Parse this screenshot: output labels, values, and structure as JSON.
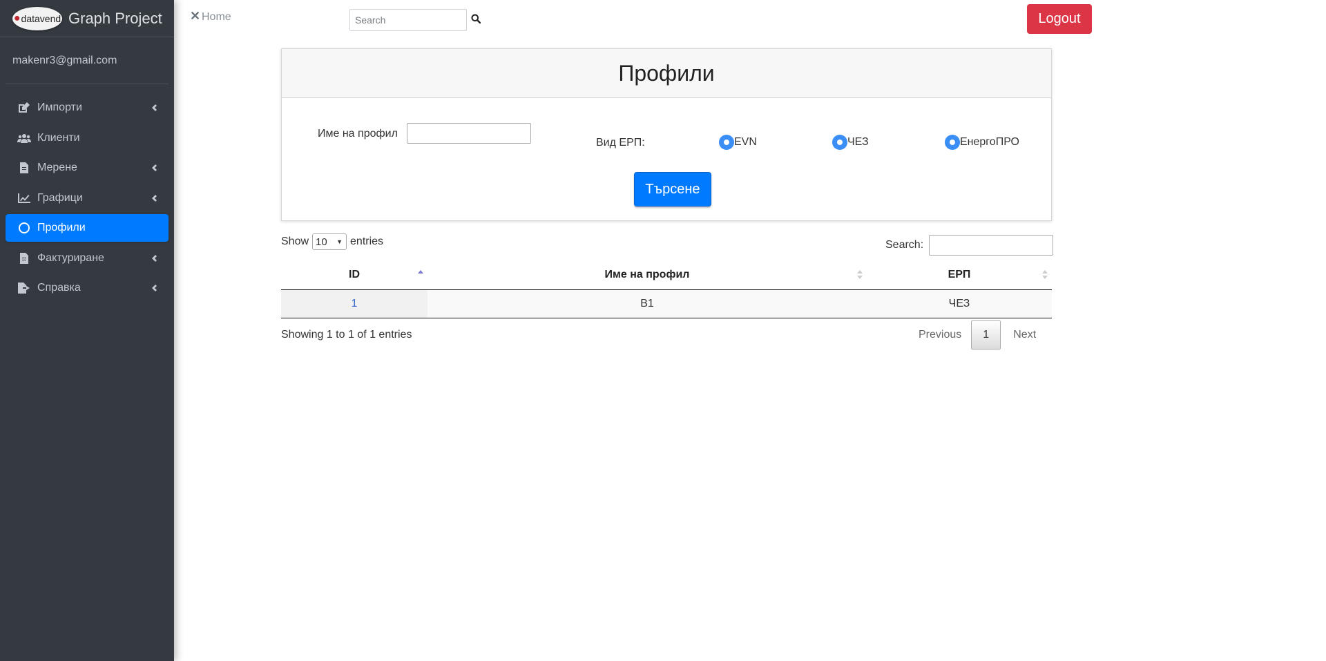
{
  "sidebar": {
    "logo_text": "datavend",
    "brand_title": "Graph Project",
    "user_email": "makenr3@gmail.com",
    "items": [
      {
        "label": "Импорти"
      },
      {
        "label": "Клиенти"
      },
      {
        "label": "Мерене"
      },
      {
        "label": "Графици"
      },
      {
        "label": "Профили"
      },
      {
        "label": "Фактуриране"
      },
      {
        "label": "Справка"
      }
    ]
  },
  "topbar": {
    "close_glyph": "✕",
    "home_label": "Home",
    "search_placeholder": "Search",
    "logout_label": "Logout"
  },
  "card": {
    "title": "Профили",
    "profile_name_label": "Име на профил",
    "erp_label": "Вид ЕРП:",
    "radios": [
      {
        "label": "EVN"
      },
      {
        "label": "ЧЕЗ"
      },
      {
        "label": "ЕнергоПРО"
      }
    ],
    "submit_label": "Търсене"
  },
  "table": {
    "show_label": "Show",
    "entries_label": "entries",
    "page_length": "10",
    "search_label": "Search:",
    "columns": [
      "ID",
      "Име на профил",
      "ЕРП"
    ],
    "rows": [
      {
        "id": "1",
        "name": "B1",
        "erp": "ЧЕЗ"
      }
    ],
    "info": "Showing 1 to 1 of 1 entries",
    "pagination": {
      "previous": "Previous",
      "current": "1",
      "next": "Next"
    }
  },
  "colors": {
    "sidebar_bg": "#343a40",
    "active": "#007bff",
    "logout": "#dc3545"
  }
}
